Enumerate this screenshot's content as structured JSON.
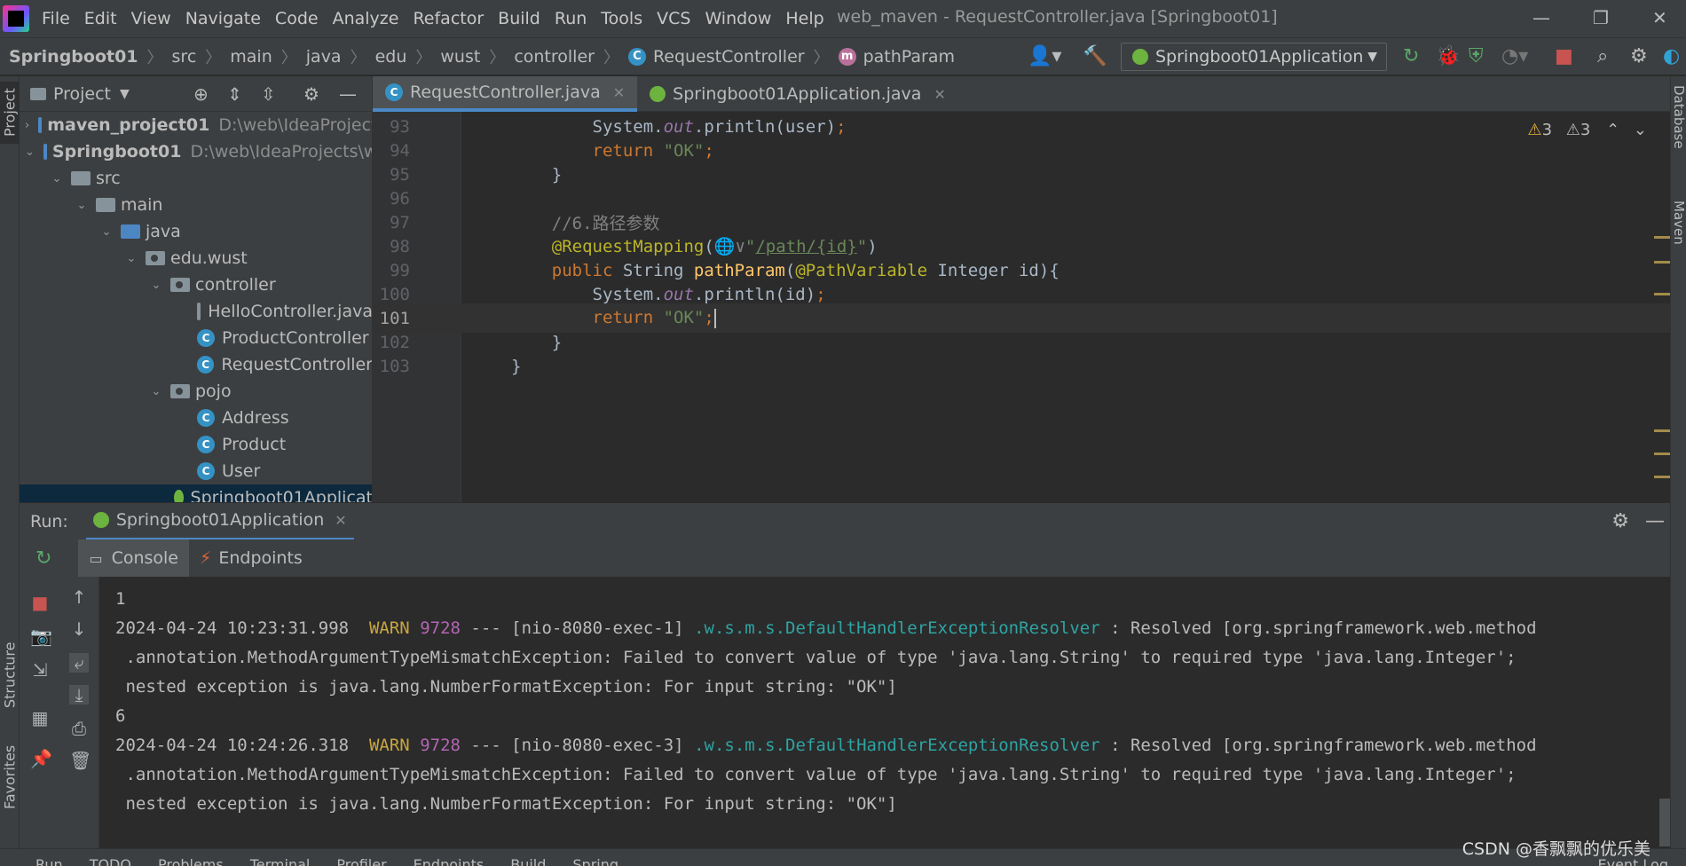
{
  "menubar": {
    "items": [
      "File",
      "Edit",
      "View",
      "Navigate",
      "Code",
      "Analyze",
      "Refactor",
      "Build",
      "Run",
      "Tools",
      "VCS",
      "Window",
      "Help"
    ],
    "title": "web_maven - RequestController.java [Springboot01]"
  },
  "navbar": {
    "crumbs": [
      "Springboot01",
      "src",
      "main",
      "java",
      "edu",
      "wust",
      "controller",
      "RequestController",
      "pathParam"
    ],
    "run_config": "Springboot01Application"
  },
  "left_strip": {
    "project": "Project",
    "structure": "Structure",
    "favorites": "Favorites"
  },
  "right_strip": {
    "database": "Database",
    "maven": "Maven"
  },
  "project_panel": {
    "title": "Project",
    "tree": [
      {
        "label": "maven_project01",
        "path": "D:\\web\\IdeaProject"
      },
      {
        "label": "Springboot01",
        "path": "D:\\web\\IdeaProjects\\w"
      },
      {
        "label": "src"
      },
      {
        "label": "main"
      },
      {
        "label": "java"
      },
      {
        "label": "edu.wust"
      },
      {
        "label": "controller"
      },
      {
        "label": "HelloController.java"
      },
      {
        "label": "ProductController"
      },
      {
        "label": "RequestController"
      },
      {
        "label": "pojo"
      },
      {
        "label": "Address"
      },
      {
        "label": "Product"
      },
      {
        "label": "User"
      },
      {
        "label": "Springboot01Applicat"
      }
    ]
  },
  "editor": {
    "tabs": [
      "RequestController.java",
      "Springboot01Application.java"
    ],
    "warnings": [
      "3",
      "3"
    ],
    "lines": [
      {
        "n": "93",
        "parts": [
          [
            "",
            "        System."
          ],
          [
            "fld",
            "out"
          ],
          [
            "",
            ".println(user)"
          ],
          [
            "kw",
            ";"
          ]
        ]
      },
      {
        "n": "94",
        "parts": [
          [
            "kw",
            "        return "
          ],
          [
            "str",
            "\"OK\""
          ],
          [
            "kw",
            ";"
          ]
        ]
      },
      {
        "n": "95",
        "parts": [
          [
            "",
            "    }"
          ]
        ]
      },
      {
        "n": "96",
        "parts": [
          [
            "",
            ""
          ]
        ]
      },
      {
        "n": "97",
        "parts": [
          [
            "cmt",
            "    //6.路径参数"
          ]
        ]
      },
      {
        "n": "98",
        "parts": [
          [
            "ann",
            "    @RequestMapping"
          ],
          [
            "",
            "("
          ],
          [
            "cmt",
            "🌐∨"
          ],
          [
            "str",
            "\""
          ],
          [
            "url",
            "/path/{id}"
          ],
          [
            "str",
            "\""
          ],
          [
            "",
            ")"
          ]
        ]
      },
      {
        "n": "99",
        "parts": [
          [
            "kw",
            "    public "
          ],
          [
            "",
            "String "
          ],
          [
            "fn",
            "pathParam"
          ],
          [
            "",
            "("
          ],
          [
            "ann",
            "@PathVariable"
          ],
          [
            "",
            " Integer id){"
          ]
        ]
      },
      {
        "n": "100",
        "parts": [
          [
            "",
            "        System."
          ],
          [
            "fld",
            "out"
          ],
          [
            "",
            ".println(id)"
          ],
          [
            "kw",
            ";"
          ]
        ]
      },
      {
        "n": "101",
        "parts": [
          [
            "kw",
            "        return "
          ],
          [
            "str",
            "\"OK\""
          ],
          [
            "kw",
            ";"
          ]
        ]
      },
      {
        "n": "102",
        "parts": [
          [
            "",
            "    }"
          ]
        ]
      },
      {
        "n": "103",
        "parts": [
          [
            "",
            "}"
          ]
        ]
      }
    ]
  },
  "run": {
    "label": "Run:",
    "config_tab": "Springboot01Application",
    "subtabs": [
      "Console",
      "Endpoints"
    ],
    "console": [
      {
        "parts": [
          [
            "",
            "1"
          ]
        ]
      },
      {
        "parts": [
          [
            "",
            "2024-04-24 10:23:31.998  "
          ],
          [
            "warn",
            "WARN"
          ],
          [
            "",
            " "
          ],
          [
            "pid",
            "9728"
          ],
          [
            "",
            " --- [nio-8080-exec-1] "
          ],
          [
            "logger",
            ".w.s.m.s.DefaultHandlerExceptionResolver"
          ],
          [
            "",
            " : Resolved [org.springframework.web.method"
          ]
        ]
      },
      {
        "parts": [
          [
            "",
            " .annotation.MethodArgumentTypeMismatchException: Failed to convert value of type 'java.lang.String' to required type 'java.lang.Integer';"
          ]
        ]
      },
      {
        "parts": [
          [
            "",
            " nested exception is java.lang.NumberFormatException: For input string: \"OK\"]"
          ]
        ]
      },
      {
        "parts": [
          [
            "",
            "6"
          ]
        ]
      },
      {
        "parts": [
          [
            "",
            "2024-04-24 10:24:26.318  "
          ],
          [
            "warn",
            "WARN"
          ],
          [
            "",
            " "
          ],
          [
            "pid",
            "9728"
          ],
          [
            "",
            " --- [nio-8080-exec-3] "
          ],
          [
            "logger",
            ".w.s.m.s.DefaultHandlerExceptionResolver"
          ],
          [
            "",
            " : Resolved [org.springframework.web.method"
          ]
        ]
      },
      {
        "parts": [
          [
            "",
            " .annotation.MethodArgumentTypeMismatchException: Failed to convert value of type 'java.lang.String' to required type 'java.lang.Integer';"
          ]
        ]
      },
      {
        "parts": [
          [
            "",
            " nested exception is java.lang.NumberFormatException: For input string: \"OK\"]"
          ]
        ]
      }
    ]
  },
  "statusbar": {
    "items": [
      "Run",
      "TODO",
      "Problems",
      "Terminal",
      "Profiler",
      "Endpoints",
      "Build",
      "Spring"
    ],
    "event_log": "Event Log"
  },
  "watermark": "CSDN @香飘飘的优乐美",
  "colors": {
    "accent": "#4a88c7",
    "spring": "#6db33f",
    "warn": "#c9a640"
  }
}
